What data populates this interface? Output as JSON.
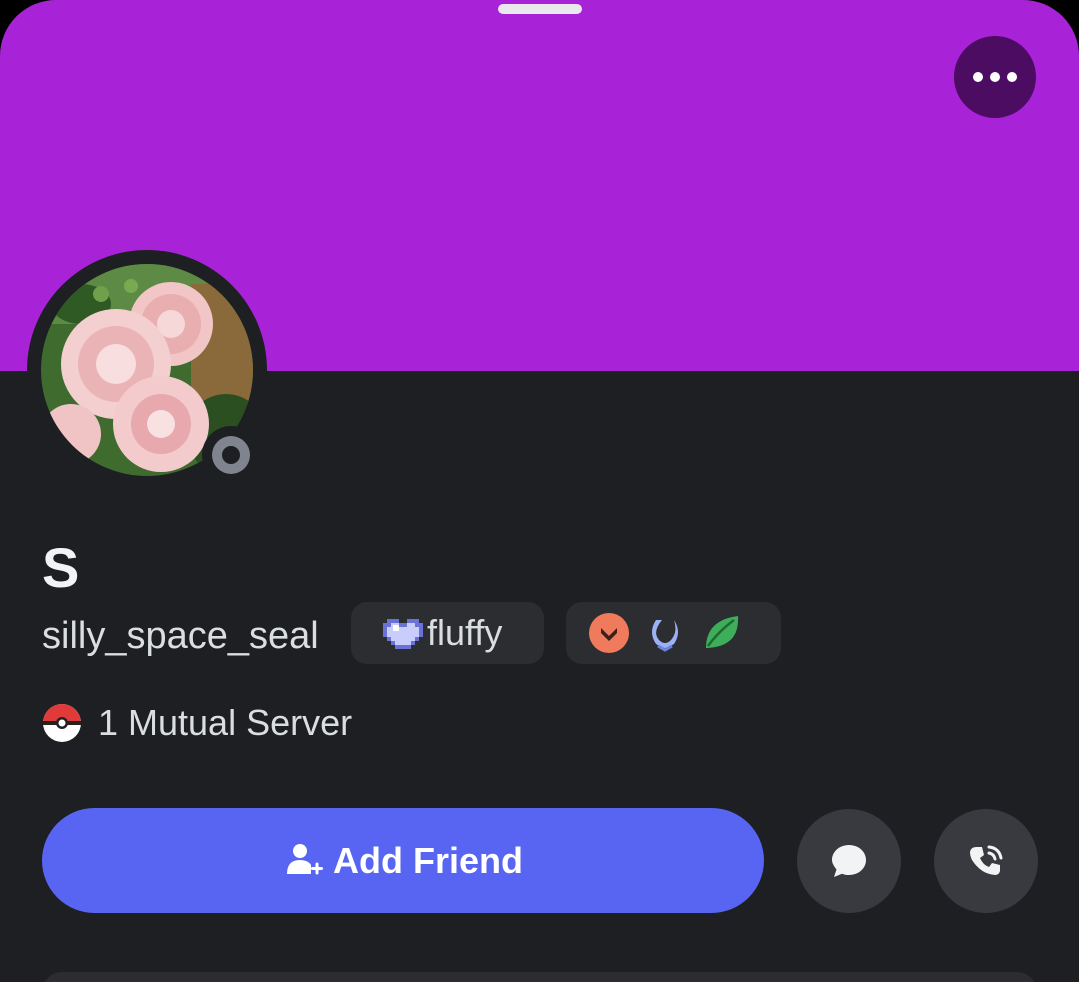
{
  "profile": {
    "display_name": "S",
    "username": "silly_space_seal",
    "status": "offline",
    "banner_color": "#a822d8",
    "avatar": "pink-roses-avatar"
  },
  "tag": {
    "icon": "pixel-heart-icon",
    "text": "fluffy"
  },
  "badges": [
    "hypesquad-chevron-badge",
    "laurel-badge",
    "leaf-badge"
  ],
  "mutual": {
    "icon": "pokeball-server-icon",
    "text": "1 Mutual Server"
  },
  "actions": {
    "add_friend_label": "Add Friend",
    "message_icon": "message-bubble-icon",
    "call_icon": "phone-call-icon",
    "more_icon": "more-dots-icon"
  },
  "colors": {
    "accent": "#5865f2",
    "background": "#1e1f22",
    "chip": "#2b2d31"
  }
}
